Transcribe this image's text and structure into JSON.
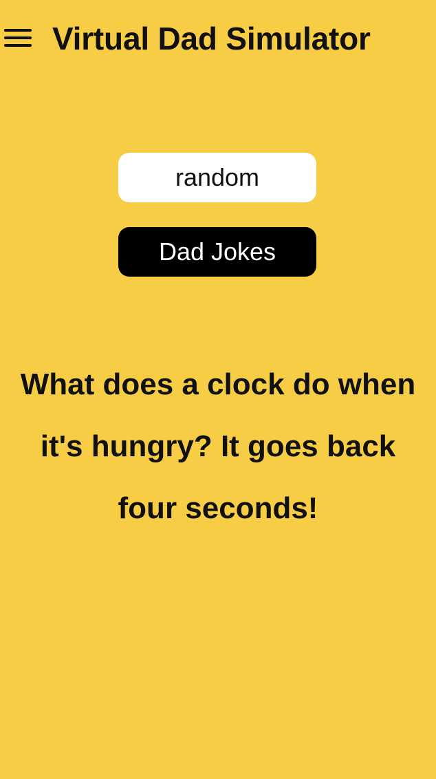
{
  "header": {
    "title": "Virtual Dad Simulator",
    "menu_icon": "hamburger-menu-icon"
  },
  "controls": {
    "category_value": "random",
    "jokes_button_label": "Dad Jokes"
  },
  "joke": {
    "text": "What does a clock do when it's hungry? It goes back four seconds!"
  },
  "colors": {
    "background": "#F8CD46",
    "button_dark": "#000000",
    "select_bg": "#FFFFFF",
    "text": "#111111"
  }
}
